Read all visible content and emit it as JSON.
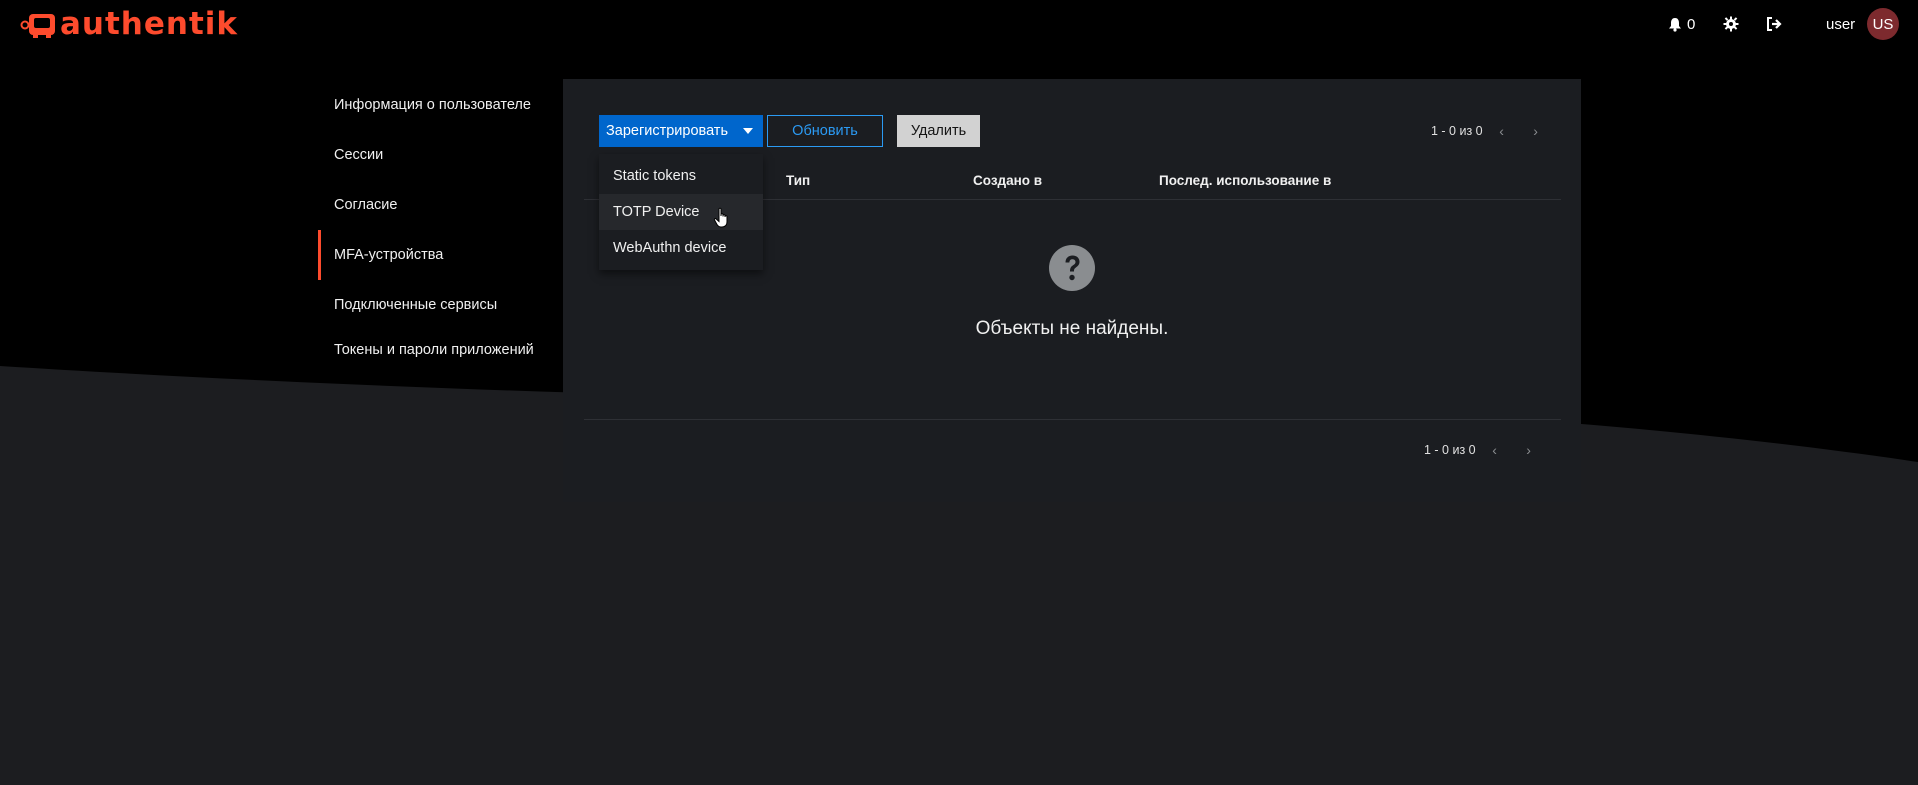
{
  "app": {
    "brand": "authentik",
    "brand_color": "#fd4b2d"
  },
  "header": {
    "notifications_count": "0",
    "username": "user",
    "avatar_initials": "US"
  },
  "sidebar": {
    "items": [
      {
        "label": "Информация о пользователе",
        "active": false
      },
      {
        "label": "Сессии",
        "active": false
      },
      {
        "label": "Согласие",
        "active": false
      },
      {
        "label": "MFA-устройства",
        "active": true
      },
      {
        "label": "Подключенные сервисы",
        "active": false
      },
      {
        "label": "Токены и пароли приложений",
        "active": false
      }
    ]
  },
  "toolbar": {
    "register_label": "Зарегистрировать",
    "refresh_label": "Обновить",
    "delete_label": "Удалить"
  },
  "dropdown": {
    "items": [
      "Static tokens",
      "TOTP Device",
      "WebAuthn device"
    ],
    "hovered_index": 1
  },
  "table": {
    "columns": [
      "Тип",
      "Создано в",
      "Послед. использование в"
    ]
  },
  "pagination": {
    "text": "1 - 0 из 0"
  },
  "empty_state": {
    "text": "Объекты не найдены."
  }
}
